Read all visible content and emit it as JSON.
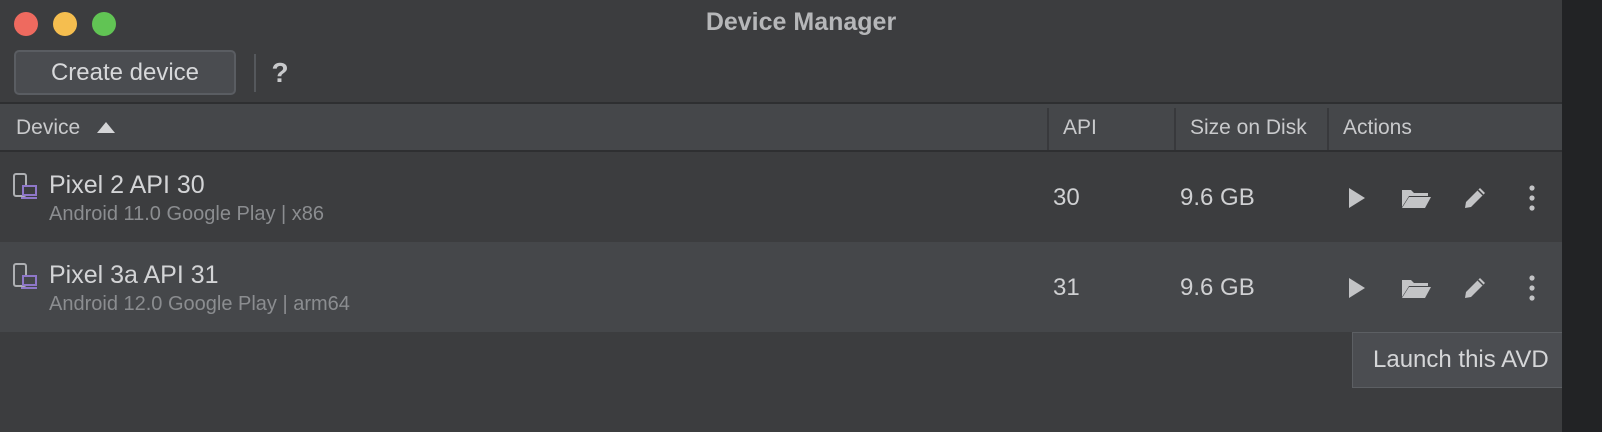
{
  "window": {
    "title": "Device Manager"
  },
  "toolbar": {
    "create_label": "Create device",
    "help_label": "?"
  },
  "table": {
    "columns": [
      "Device",
      "API",
      "Size on Disk",
      "Actions"
    ],
    "sort": {
      "column": "Device",
      "direction": "ascending"
    },
    "rows": [
      {
        "name": "Pixel 2 API 30",
        "details": "Android 11.0 Google Play | x86",
        "api": "30",
        "size": "9.6 GB",
        "actions": [
          "play-icon",
          "folder-icon",
          "pencil-icon",
          "more-vertical-icon"
        ]
      },
      {
        "name": "Pixel 3a API 31",
        "details": "Android 12.0 Google Play | arm64",
        "api": "31",
        "size": "9.6 GB",
        "actions": [
          "play-icon",
          "folder-icon",
          "pencil-icon",
          "more-vertical-icon"
        ]
      }
    ]
  },
  "tooltip": {
    "text": "Launch this AVD"
  },
  "colors": {
    "window_bg": "#3c3d3f",
    "header_bg": "#45474a",
    "selected_row_bg": "#45474a",
    "device_icon_accent": "#8e77c9",
    "traffic_red": "#ee6a5f",
    "traffic_yellow": "#f5be4f",
    "traffic_green": "#61c454"
  }
}
